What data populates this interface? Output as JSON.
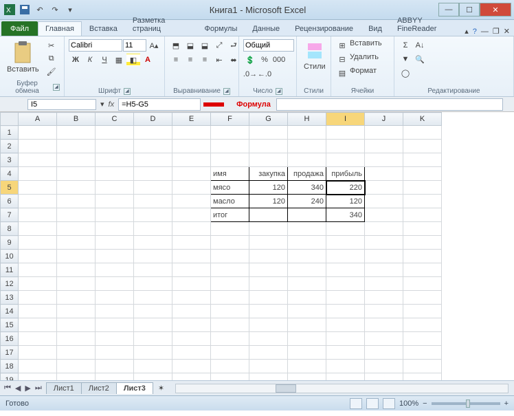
{
  "title": "Книга1 - Microsoft Excel",
  "tabs": {
    "file": "Файл",
    "home": "Главная",
    "insert": "Вставка",
    "layout": "Разметка страниц",
    "formulas": "Формулы",
    "data": "Данные",
    "review": "Рецензирование",
    "view": "Вид",
    "abbyy": "ABBYY FineReader"
  },
  "ribbon": {
    "clipboard": {
      "paste": "Вставить",
      "label": "Буфер обмена"
    },
    "font": {
      "name": "Calibri",
      "size": "11",
      "label": "Шрифт"
    },
    "align": {
      "label": "Выравнивание"
    },
    "number": {
      "format": "Общий",
      "label": "Число"
    },
    "styles": {
      "btn": "Стили",
      "label": "Стили"
    },
    "cells": {
      "insert": "Вставить",
      "delete": "Удалить",
      "format": "Формат",
      "label": "Ячейки"
    },
    "editing": {
      "label": "Редактирование"
    }
  },
  "namebox": "I5",
  "formula": "=H5-G5",
  "annotation": "Формула",
  "columns": [
    "A",
    "B",
    "C",
    "D",
    "E",
    "F",
    "G",
    "H",
    "I",
    "J",
    "K"
  ],
  "rows": 19,
  "selected": {
    "col": "I",
    "row": 5
  },
  "data_region": {
    "r4": {
      "F": "имя",
      "G": "закупка",
      "H": "продажа",
      "I": "прибыль"
    },
    "r5": {
      "F": "мясо",
      "G": "120",
      "H": "340",
      "I": "220"
    },
    "r6": {
      "F": "масло",
      "G": "120",
      "H": "240",
      "I": "120"
    },
    "r7": {
      "F": "итог",
      "G": "",
      "H": "",
      "I": "340"
    }
  },
  "sheets": {
    "s1": "Лист1",
    "s2": "Лист2",
    "s3": "Лист3"
  },
  "status": {
    "ready": "Готово",
    "zoom": "100%"
  },
  "chart_data": {
    "type": "table",
    "title": "",
    "columns": [
      "имя",
      "закупка",
      "продажа",
      "прибыль"
    ],
    "rows": [
      [
        "мясо",
        120,
        340,
        220
      ],
      [
        "масло",
        120,
        240,
        120
      ],
      [
        "итог",
        null,
        null,
        340
      ]
    ],
    "formula": "I5 = H5 - G5"
  }
}
